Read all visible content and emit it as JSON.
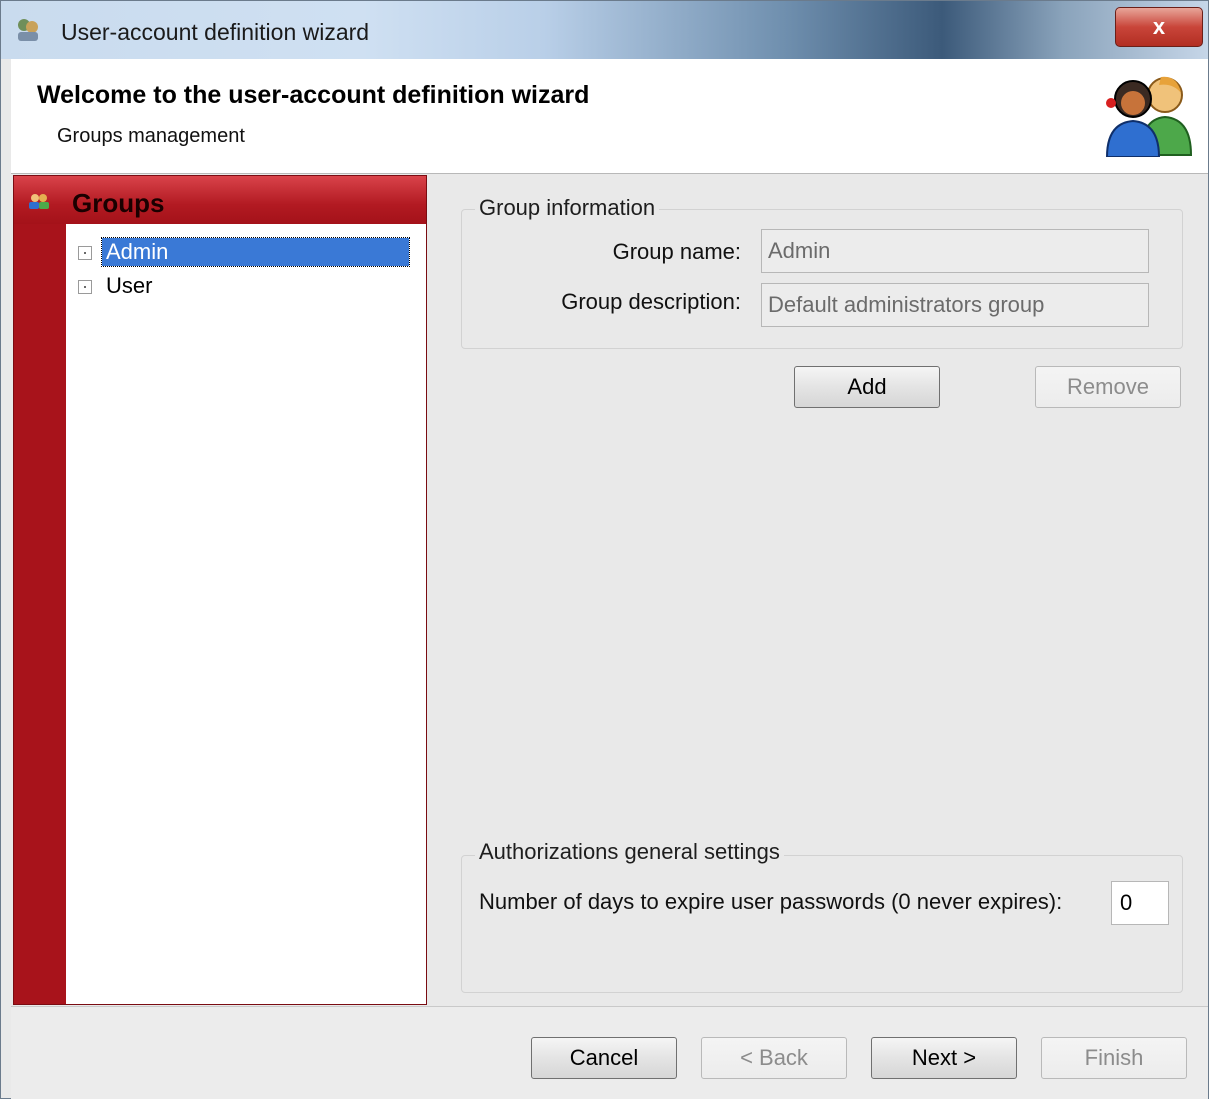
{
  "window": {
    "title": "User-account definition wizard",
    "close_label": "x"
  },
  "header": {
    "title": "Welcome to the user-account definition wizard",
    "subtitle": "Groups management",
    "icon": "users-icon"
  },
  "sidebar": {
    "title": "Groups",
    "icon": "groups-icon",
    "items": [
      {
        "label": "Admin",
        "selected": true
      },
      {
        "label": "User",
        "selected": false
      }
    ]
  },
  "group_info": {
    "legend": "Group information",
    "name_label": "Group name:",
    "name_value": "Admin",
    "description_label": "Group description:",
    "description_value": "Default administrators group",
    "add_label": "Add",
    "remove_label": "Remove"
  },
  "authorizations": {
    "legend": "Authorizations general settings",
    "days_label": "Number of days to expire user passwords (0 never expires):",
    "days_value": "0"
  },
  "footer": {
    "cancel_label": "Cancel",
    "back_label": "< Back",
    "next_label": "Next >",
    "finish_label": "Finish"
  },
  "colors": {
    "sidebar_accent": "#a8131b",
    "selection": "#3a79d6"
  }
}
